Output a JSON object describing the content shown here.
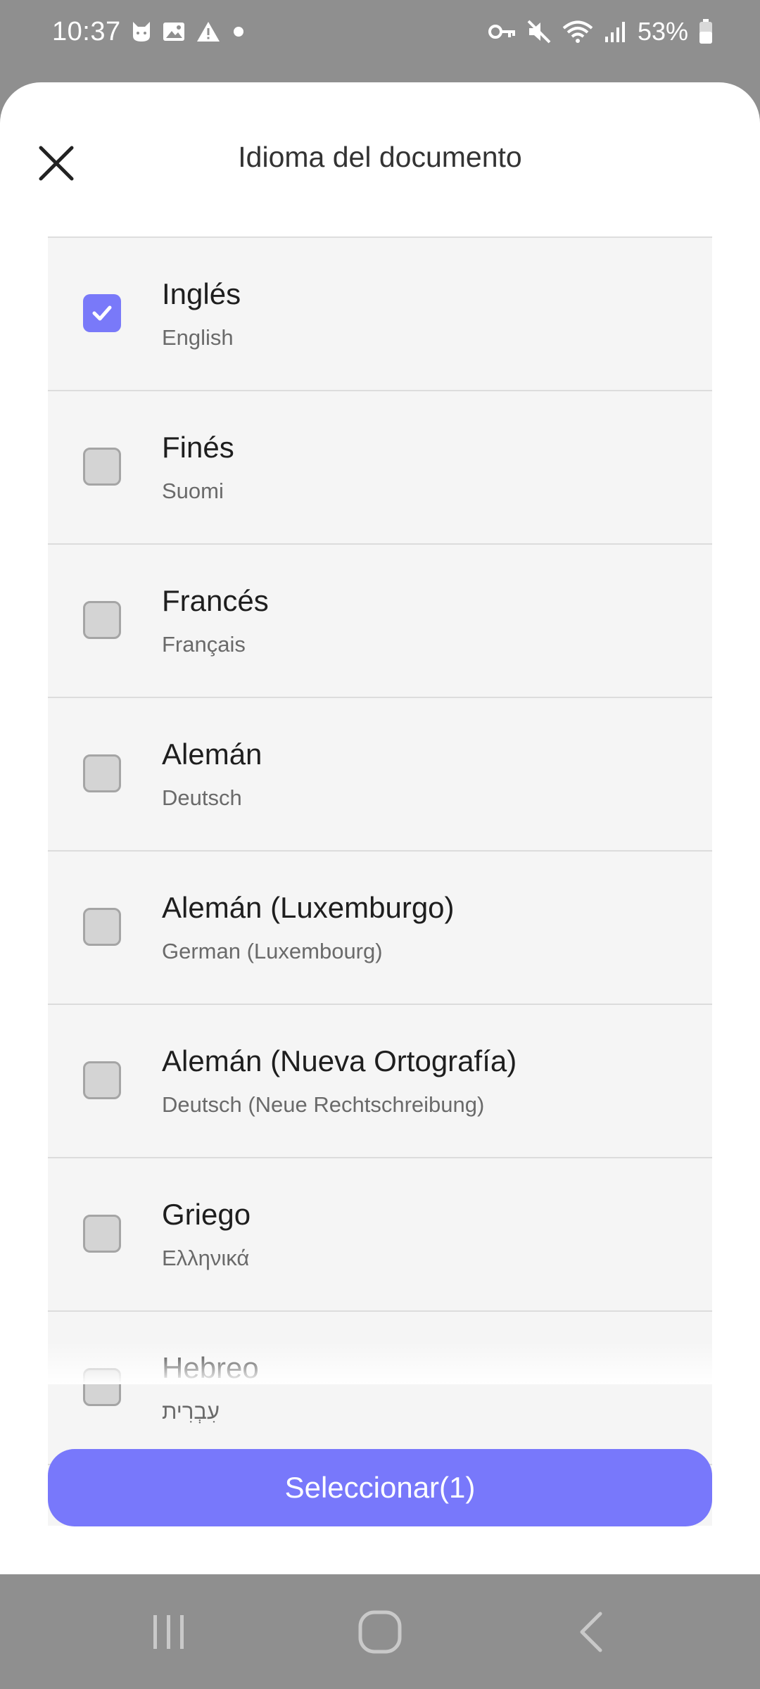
{
  "status_bar": {
    "time": "10:37",
    "battery_percent": "53%",
    "left_icons": [
      "cat-icon",
      "image-icon",
      "warning-icon",
      "dot-icon"
    ],
    "right_icons": [
      "key-icon",
      "mute-icon",
      "wifi-icon",
      "signal-icon",
      "battery-icon"
    ]
  },
  "sheet": {
    "title": "Idioma del documento",
    "close_icon": "close-icon"
  },
  "languages": [
    {
      "name": "Inglés",
      "native": "English",
      "checked": true
    },
    {
      "name": "Finés",
      "native": "Suomi",
      "checked": false
    },
    {
      "name": "Francés",
      "native": "Français",
      "checked": false
    },
    {
      "name": "Alemán",
      "native": "Deutsch",
      "checked": false
    },
    {
      "name": "Alemán (Luxemburgo)",
      "native": "German (Luxembourg)",
      "checked": false
    },
    {
      "name": "Alemán (Nueva Ortografía)",
      "native": "Deutsch (Neue Rechtschreibung)",
      "checked": false
    },
    {
      "name": "Griego",
      "native": "Ελληνικά",
      "checked": false
    },
    {
      "name": "Hebreo",
      "native": "עִבְרִית",
      "checked": false
    }
  ],
  "select_button": {
    "label": "Seleccionar(1)"
  },
  "nav_bar": {
    "icons": [
      "recent-apps-icon",
      "home-icon",
      "back-icon"
    ]
  },
  "colors": {
    "accent": "#7878fb",
    "checkbox_checked": "#7979f9",
    "list_background": "#f5f5f5",
    "backdrop": "#8f8f8f"
  }
}
